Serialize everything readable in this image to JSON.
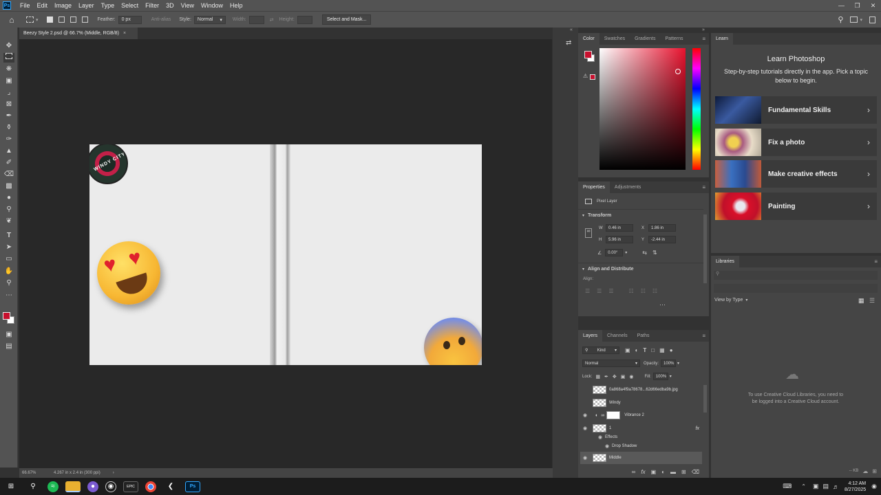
{
  "menu": {
    "logo": "Ps",
    "items": [
      "File",
      "Edit",
      "Image",
      "Layer",
      "Type",
      "Select",
      "Filter",
      "3D",
      "View",
      "Window",
      "Help"
    ]
  },
  "options": {
    "feather_label": "Feather:",
    "feather_value": "0 px",
    "antialias_label": "Anti-alias",
    "style_label": "Style:",
    "style_value": "Normal",
    "width_label": "Width:",
    "height_label": "Height:",
    "select_mask_label": "Select and Mask..."
  },
  "document": {
    "tab_title": "Beezy Style 2.psd @ 66.7% (Middle, RGB/8)",
    "tab_close": "×",
    "zoom": "66.67%",
    "doc_info": "4.267 in x 2.4 in (300 ppi)",
    "badge_text": "WINDY CITY"
  },
  "color_panel": {
    "tabs": [
      "Color",
      "Swatches",
      "Gradients",
      "Patterns"
    ],
    "foreground": "#c8102e"
  },
  "properties": {
    "tabs": [
      "Properties",
      "Adjustments"
    ],
    "layer_type": "Pixel Layer",
    "transform_label": "Transform",
    "w_label": "W",
    "w_value": "0.46 in",
    "h_label": "H",
    "h_value": "5.96 in",
    "x_label": "X",
    "x_value": "1.86 in",
    "y_label": "Y",
    "y_value": "-2.44 in",
    "angle_value": "0.00°",
    "align_label": "Align and Distribute",
    "align_sub": "Align:"
  },
  "layers": {
    "tabs": [
      "Layers",
      "Channels",
      "Paths"
    ],
    "kind_label": "Kind",
    "blend_mode": "Normal",
    "opacity_label": "Opacity:",
    "opacity_value": "100%",
    "lock_label": "Lock:",
    "fill_label": "Fill:",
    "fill_value": "100%",
    "items": [
      {
        "name": "0a868a4f9a78678...62d66edba9b.jpg"
      },
      {
        "name": "Windy"
      },
      {
        "name": "Vibrance 2"
      },
      {
        "name": "1"
      },
      {
        "name": "Effects"
      },
      {
        "name": "Drop Shadow"
      },
      {
        "name": "Middle"
      }
    ]
  },
  "learn": {
    "tab": "Learn",
    "title": "Learn Photoshop",
    "description": "Step-by-step tutorials directly in the app. Pick a topic below to begin.",
    "cards": [
      {
        "label": "Fundamental Skills"
      },
      {
        "label": "Fix a photo"
      },
      {
        "label": "Make creative effects"
      },
      {
        "label": "Painting"
      }
    ]
  },
  "libraries": {
    "tab": "Libraries",
    "view_label": "View by Type",
    "message": "To use Creative Cloud Libraries, you need to be logged into a Creative Cloud account.",
    "size_label": "-- KB"
  },
  "taskbar": {
    "epic_label": "EPIC",
    "time": "4:12 AM",
    "date": "8/27/2025"
  }
}
